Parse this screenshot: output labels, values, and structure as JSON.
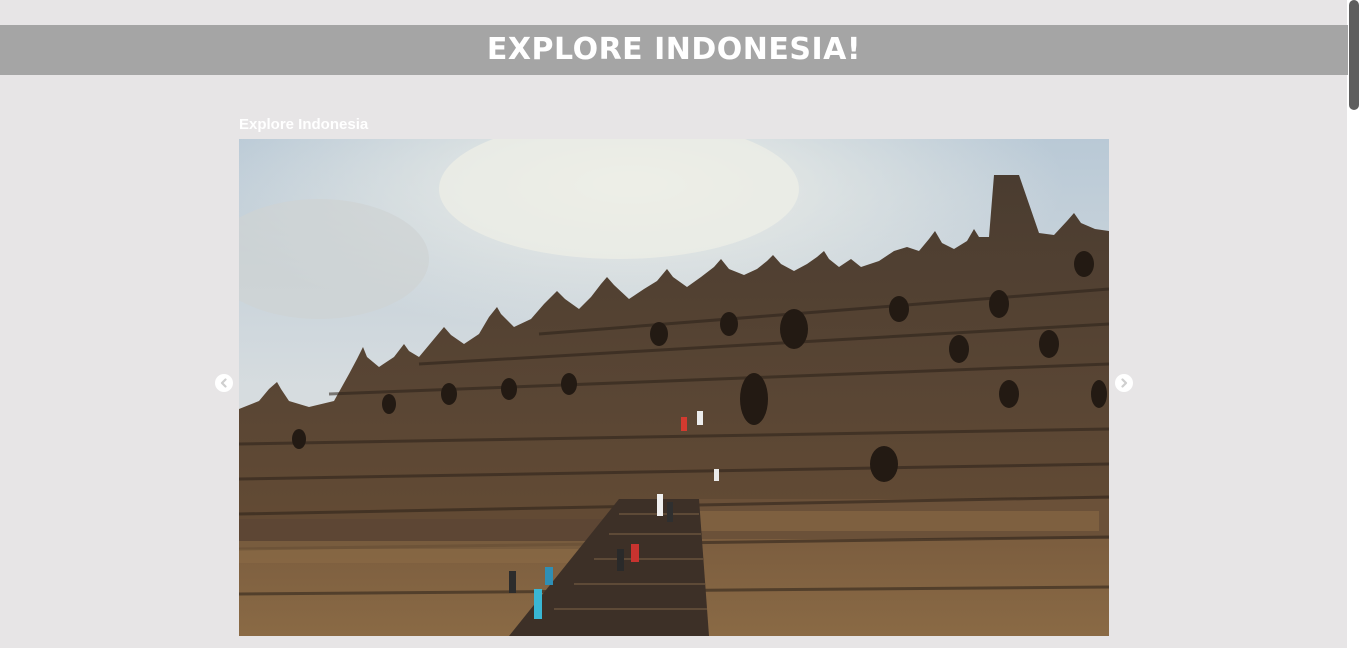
{
  "header": {
    "title": "EXPLORE INDONESIA!"
  },
  "carousel": {
    "caption": "Explore Indonesia",
    "image_subject": "Borobudur temple with visitors climbing the stone steps",
    "prev_icon": "chevron-left-icon",
    "next_icon": "chevron-right-icon"
  },
  "colors": {
    "page_background": "#e7e5e6",
    "header_background": "#a5a5a5",
    "header_text": "#ffffff",
    "scrollbar_thumb": "#5e5e5e"
  }
}
